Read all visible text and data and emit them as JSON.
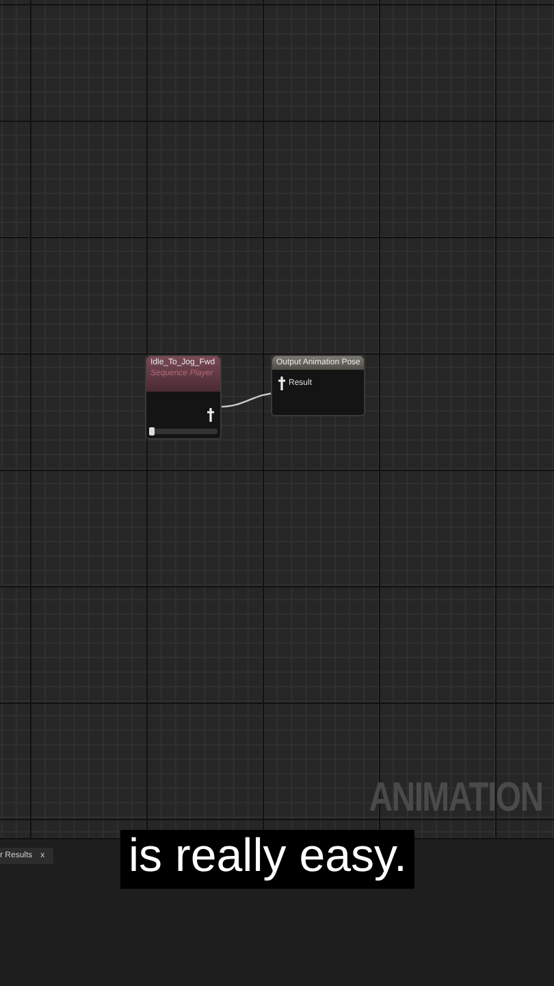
{
  "graph": {
    "nodes": [
      {
        "kind": "sequence_player",
        "title": "Idle_To_Jog_Fwd",
        "subtitle": "Sequence Player",
        "level": 0
      },
      {
        "kind": "output_pose",
        "title": "Output Animation Pose",
        "pin": "Result"
      }
    ],
    "corner_label": "ANIMATION"
  },
  "bottom_panel": {
    "tabs": [
      {
        "label": "r Results",
        "close": "x"
      }
    ]
  },
  "caption": "is really easy."
}
